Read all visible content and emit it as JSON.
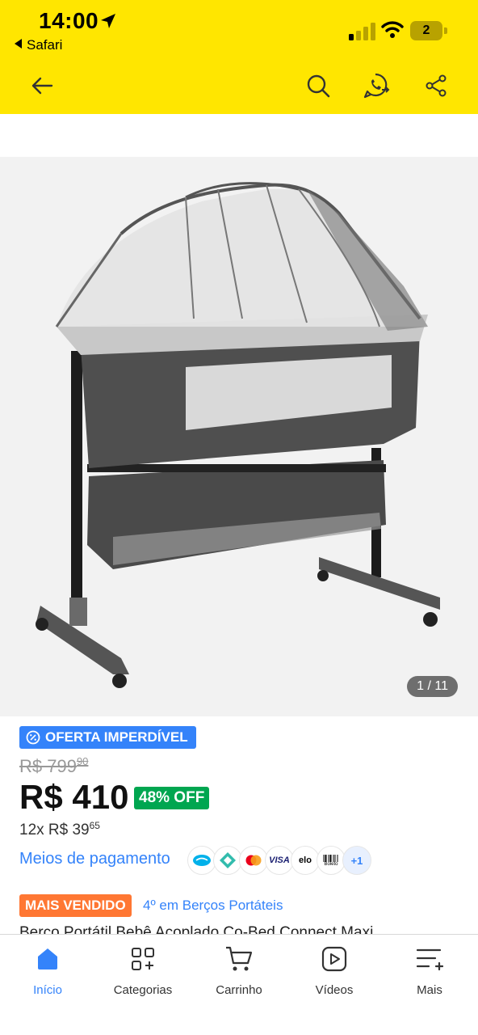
{
  "status_bar": {
    "time": "14:00",
    "back_app": "Safari",
    "battery": "2"
  },
  "header": {
    "icons": [
      "back-arrow-icon",
      "search-icon",
      "whatsapp-share-icon",
      "share-icon"
    ],
    "accent": "#FFE600"
  },
  "gallery": {
    "counter": "1 / 11"
  },
  "product": {
    "deal_label": "OFERTA IMPERDÍVEL",
    "old_price_main": "R$ 799",
    "old_price_cents": "90",
    "price": "R$ 410",
    "discount": "48% OFF",
    "installments_main": "12x R$ 39",
    "installments_cents": "65",
    "payment_link": "Meios de pagamento",
    "payment_more": "+1",
    "payment_icons": [
      "mercado-pago-icon",
      "pix-icon",
      "mastercard-icon",
      "visa-icon",
      "elo-icon",
      "boleto-icon"
    ],
    "visa_text": "VISA",
    "elo_text": "elo",
    "boleto_text": "Boleto",
    "badge": "MAIS VENDIDO",
    "rank": "4º em Berços Portáteis",
    "title": "Berço Portátil Bebê Acoplado Co-Bed Connect Maxi"
  },
  "bottom_nav": {
    "items": [
      {
        "label": "Início",
        "icon": "home-icon",
        "active": true
      },
      {
        "label": "Categorias",
        "icon": "categories-icon",
        "active": false
      },
      {
        "label": "Carrinho",
        "icon": "cart-icon",
        "active": false
      },
      {
        "label": "Vídeos",
        "icon": "video-icon",
        "active": false
      },
      {
        "label": "Mais",
        "icon": "more-icon",
        "active": false
      }
    ]
  },
  "colors": {
    "brand_yellow": "#FFE600",
    "link_blue": "#3483FA",
    "green_off": "#00A650",
    "orange_badge": "#FF7733"
  }
}
